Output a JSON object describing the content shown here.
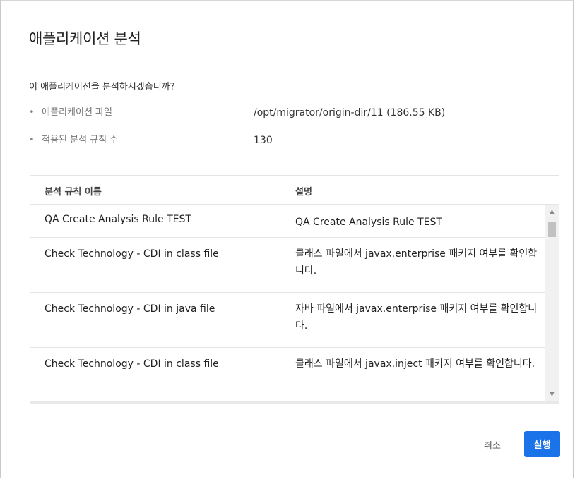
{
  "dialog": {
    "title": "애플리케이션 분석",
    "question": "이 애플리케이션을 분석하시겠습니까?",
    "info": [
      {
        "bullet": "•",
        "label": "애플리케이션 파일",
        "value": "/opt/migrator/origin-dir/11 (186.55 KB)"
      },
      {
        "bullet": "•",
        "label": "적용된 분석 규칙 수",
        "value": "130"
      }
    ]
  },
  "table": {
    "headers": {
      "name": "분석 규칙 이름",
      "desc": "설명"
    },
    "rows": [
      {
        "name": "QA Create Analysis Rule TEST",
        "desc": "QA Create Analysis Rule TEST"
      },
      {
        "name": "Check Technology - CDI in class file",
        "desc": "클래스 파일에서 javax.enterprise 패키지 여부를 확인합니다."
      },
      {
        "name": "Check Technology - CDI in java file",
        "desc": "자바 파일에서 javax.enterprise 패키지 여부를 확인합니다."
      },
      {
        "name": "Check Technology - CDI in class file",
        "desc": "클래스 파일에서 javax.inject 패키지 여부를 확인합니다."
      }
    ],
    "scrollbar": {
      "up_icon": "▲",
      "down_icon": "▼"
    }
  },
  "footer": {
    "cancel_label": "취소",
    "run_label": "실행"
  },
  "colors": {
    "primary_button": "#1a73e8"
  }
}
